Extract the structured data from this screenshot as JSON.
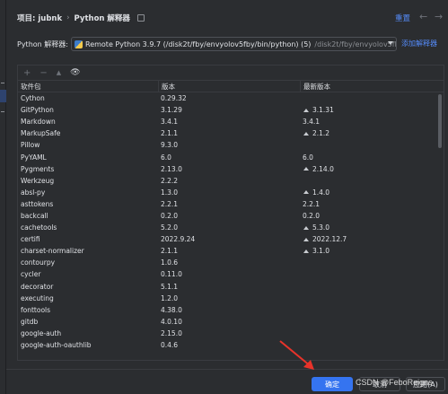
{
  "header": {
    "project": "项目: jubnk",
    "separator": "›",
    "page": "Python 解释器",
    "reset": "重置",
    "back": "←",
    "forward": "→"
  },
  "interpreter": {
    "label": "Python 解释器:",
    "value": "Remote Python 3.9.7 (/disk2t/fby/envyolov5fby/bin/python) (5)",
    "path": "/disk2t/fby/envyolov5fby/bin/p",
    "add_label": "添加解释器"
  },
  "toolbar": {
    "add": "+",
    "remove": "−",
    "upgrade": "▲",
    "eye": "👁"
  },
  "table": {
    "headers": [
      "软件包",
      "版本",
      "最新版本"
    ],
    "rows": [
      {
        "name": "Cython",
        "version": "0.29.32",
        "latest": "",
        "up": false
      },
      {
        "name": "GitPython",
        "version": "3.1.29",
        "latest": "3.1.31",
        "up": true
      },
      {
        "name": "Markdown",
        "version": "3.4.1",
        "latest": "3.4.1",
        "up": false
      },
      {
        "name": "MarkupSafe",
        "version": "2.1.1",
        "latest": "2.1.2",
        "up": true
      },
      {
        "name": "Pillow",
        "version": "9.3.0",
        "latest": "",
        "up": false
      },
      {
        "name": "PyYAML",
        "version": "6.0",
        "latest": "6.0",
        "up": false
      },
      {
        "name": "Pygments",
        "version": "2.13.0",
        "latest": "2.14.0",
        "up": true
      },
      {
        "name": "Werkzeug",
        "version": "2.2.2",
        "latest": "",
        "up": false
      },
      {
        "name": "absl-py",
        "version": "1.3.0",
        "latest": "1.4.0",
        "up": true
      },
      {
        "name": "asttokens",
        "version": "2.2.1",
        "latest": "2.2.1",
        "up": false
      },
      {
        "name": "backcall",
        "version": "0.2.0",
        "latest": "0.2.0",
        "up": false
      },
      {
        "name": "cachetools",
        "version": "5.2.0",
        "latest": "5.3.0",
        "up": true
      },
      {
        "name": "certifi",
        "version": "2022.9.24",
        "latest": "2022.12.7",
        "up": true
      },
      {
        "name": "charset-normalizer",
        "version": "2.1.1",
        "latest": "3.1.0",
        "up": true
      },
      {
        "name": "contourpy",
        "version": "1.0.6",
        "latest": "",
        "up": false
      },
      {
        "name": "cycler",
        "version": "0.11.0",
        "latest": "",
        "up": false
      },
      {
        "name": "decorator",
        "version": "5.1.1",
        "latest": "",
        "up": false
      },
      {
        "name": "executing",
        "version": "1.2.0",
        "latest": "",
        "up": false
      },
      {
        "name": "fonttools",
        "version": "4.38.0",
        "latest": "",
        "up": false
      },
      {
        "name": "gitdb",
        "version": "4.0.10",
        "latest": "",
        "up": false
      },
      {
        "name": "google-auth",
        "version": "2.15.0",
        "latest": "",
        "up": false
      },
      {
        "name": "google-auth-oauthlib",
        "version": "0.4.6",
        "latest": "",
        "up": false
      }
    ]
  },
  "footer": {
    "ok": "确定",
    "cancel": "取消",
    "apply": "应用(A)",
    "watermark": "CSDN @FeboReigns"
  },
  "colors": {
    "accent": "#3574f0",
    "link": "#548af7",
    "annotation_arrow": "#e8332a"
  }
}
